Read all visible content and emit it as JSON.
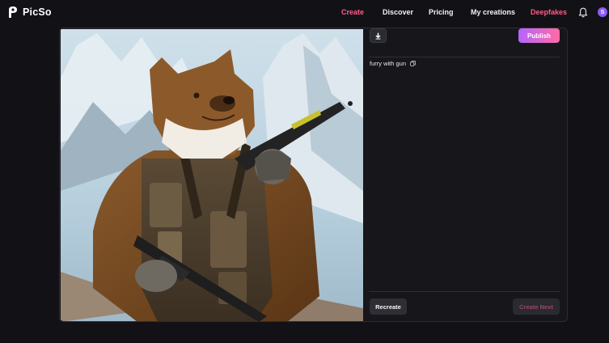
{
  "brand": {
    "name": "PicSo",
    "logo_icon": "picso-logo-icon"
  },
  "nav": {
    "links": [
      {
        "label": "Create",
        "accent": true
      },
      {
        "label": "Discover",
        "accent": false
      },
      {
        "label": "Pricing",
        "accent": false
      },
      {
        "label": "My creations",
        "accent": false
      },
      {
        "label": "Deepfakes",
        "accent": true
      }
    ],
    "bell_icon": "bell-icon",
    "avatar_initial": "S",
    "accent_color": "#ff5c8a"
  },
  "result": {
    "image_alt": "Generated image: an anthropomorphic furry bear soldier in tactical gear holding a rifle against snowy mountains",
    "download_icon": "download-icon",
    "publish_label": "Publish",
    "prompt": "furry with gun",
    "copy_icon": "copy-icon",
    "recreate_label": "Recreate",
    "create_next_label": "Create Next"
  }
}
